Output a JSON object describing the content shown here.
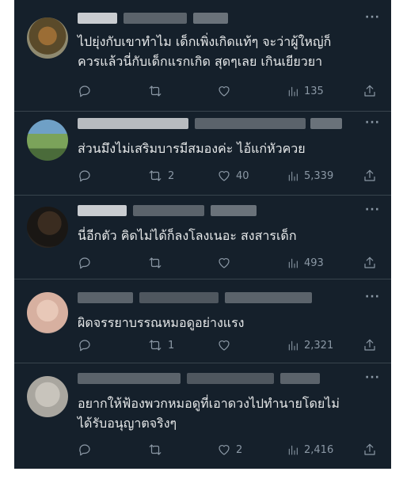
{
  "tweets": [
    {
      "text_line1": "ไปยุ่งกับเขาทำไม เด็กเพิ่งเกิดแท้ๆ จะว่าผู้ใหญ่ก็",
      "text_line2": "ควรแล้วนี่กับเด็กแรกเกิด สุดๆเลย เกินเยียวยา",
      "reply_count": "",
      "retweet_count": "",
      "like_count": "",
      "view_count": "135"
    },
    {
      "text_line1": "ส่วนมึงไม่เสริมบารมีสมองค่ะ ไอ้แก่หัวควย",
      "text_line2": "",
      "reply_count": "",
      "retweet_count": "2",
      "like_count": "40",
      "view_count": "5,339"
    },
    {
      "text_line1": "นี่อีกตัว คิดไม่ได้ก็ลงโลงเนอะ สงสารเด็ก",
      "text_line2": "",
      "reply_count": "",
      "retweet_count": "",
      "like_count": "",
      "view_count": "493"
    },
    {
      "text_line1": "ผิดจรรยาบรรณหมอดูอย่างแรง",
      "text_line2": "",
      "reply_count": "",
      "retweet_count": "1",
      "like_count": "",
      "view_count": "2,321"
    },
    {
      "text_line1": "อยากให้ฟ้องพวกหมอดูที่เอาดวงไปทำนายโดยไม่",
      "text_line2": "ได้รับอนุญาตจริงๆ",
      "reply_count": "",
      "retweet_count": "",
      "like_count": "2",
      "view_count": "2,416"
    }
  ],
  "more_label": "···",
  "colors": {
    "background": "#15202b",
    "text": "#e7e9ea",
    "muted": "#8b98a5",
    "divider": "#38444d"
  }
}
